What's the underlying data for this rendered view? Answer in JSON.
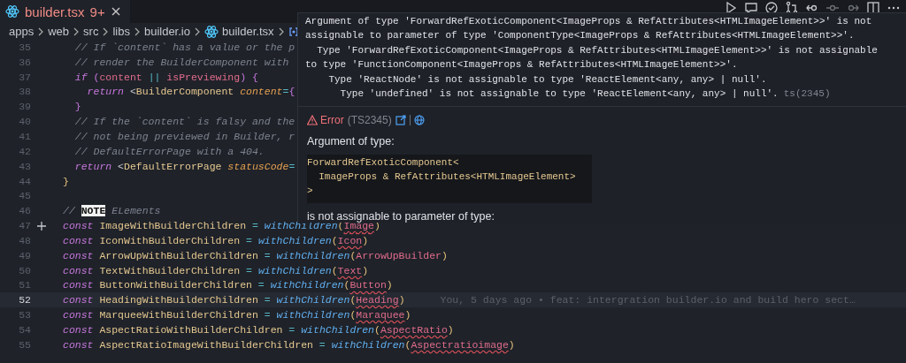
{
  "tabs": [
    {
      "label": "builder.tsx",
      "badge": "9+",
      "selected": true
    }
  ],
  "breadcrumb": [
    {
      "label": "apps",
      "kind": "folder"
    },
    {
      "label": "web",
      "kind": "folder"
    },
    {
      "label": "src",
      "kind": "folder"
    },
    {
      "label": "libs",
      "kind": "folder"
    },
    {
      "label": "builder.io",
      "kind": "folder"
    },
    {
      "label": "builder.tsx",
      "kind": "react"
    },
    {
      "kind": "symbol"
    }
  ],
  "editor": {
    "lines": [
      {
        "number": "35",
        "current": false,
        "added": false,
        "tokens": [
          {
            "kind": "comment",
            "text": "  // If `content` has a value or the p"
          }
        ]
      },
      {
        "number": "36",
        "current": false,
        "added": false,
        "tokens": [
          {
            "kind": "comment",
            "text": "  // render the BuilderComponent with"
          }
        ]
      },
      {
        "number": "37",
        "current": false,
        "added": false,
        "tokens": [
          {
            "kind": "keyword",
            "text": "  if"
          },
          {
            "kind": "punct",
            "text": " ("
          },
          {
            "kind": "var",
            "text": "content"
          },
          {
            "kind": "op",
            "text": " || "
          },
          {
            "kind": "var",
            "text": "isPreviewing"
          },
          {
            "kind": "punct",
            "text": ") {"
          }
        ]
      },
      {
        "number": "38",
        "current": false,
        "added": false,
        "tokens": [
          {
            "kind": "keyword",
            "text": "    return"
          },
          {
            "kind": "plain",
            "text": " <"
          },
          {
            "kind": "type",
            "text": "BuilderComponent"
          },
          {
            "kind": "attr",
            "text": " content"
          },
          {
            "kind": "op",
            "text": "="
          },
          {
            "kind": "punct",
            "text": "{"
          }
        ]
      },
      {
        "number": "39",
        "current": false,
        "added": false,
        "tokens": [
          {
            "kind": "punct",
            "text": "  }"
          }
        ]
      },
      {
        "number": "40",
        "current": false,
        "added": false,
        "tokens": [
          {
            "kind": "comment",
            "text": "  // If the `content` is falsy and the"
          }
        ]
      },
      {
        "number": "41",
        "current": false,
        "added": false,
        "tokens": [
          {
            "kind": "comment",
            "text": "  // not being previewed in Builder, r"
          }
        ]
      },
      {
        "number": "42",
        "current": false,
        "added": false,
        "tokens": [
          {
            "kind": "comment",
            "text": "  // DefaultErrorPage with a 404."
          }
        ]
      },
      {
        "number": "43",
        "current": false,
        "added": false,
        "tokens": [
          {
            "kind": "keyword",
            "text": "  return"
          },
          {
            "kind": "plain",
            "text": " <"
          },
          {
            "kind": "type",
            "text": "DefaultErrorPage"
          },
          {
            "kind": "attr",
            "text": " statusCode"
          },
          {
            "kind": "op",
            "text": "="
          }
        ]
      },
      {
        "number": "44",
        "current": false,
        "added": false,
        "tokens": [
          {
            "kind": "brace",
            "text": "}"
          }
        ]
      },
      {
        "number": "45",
        "current": false,
        "added": false
      },
      {
        "number": "46",
        "current": false,
        "added": false,
        "tokens": [
          {
            "kind": "comment",
            "text": "// "
          },
          {
            "kind": "note",
            "text": "NOTE"
          },
          {
            "kind": "comment",
            "text": " ELements"
          }
        ]
      },
      {
        "number": "47",
        "current": false,
        "added": true,
        "tokens": [
          {
            "kind": "keyword",
            "text": "const"
          },
          {
            "kind": "type",
            "text": " ImageWithBuilderChildren"
          },
          {
            "kind": "op",
            "text": " = "
          },
          {
            "kind": "func",
            "text": "withChildren"
          },
          {
            "kind": "brace",
            "text": "("
          },
          {
            "kind": "errvar",
            "text": "Image"
          },
          {
            "kind": "brace",
            "text": ")"
          }
        ]
      },
      {
        "number": "48",
        "current": false,
        "added": false,
        "tokens": [
          {
            "kind": "keyword",
            "text": "const"
          },
          {
            "kind": "type",
            "text": " IconWithBuilderChildren"
          },
          {
            "kind": "op",
            "text": " = "
          },
          {
            "kind": "func",
            "text": "withChildren"
          },
          {
            "kind": "brace",
            "text": "("
          },
          {
            "kind": "errvar",
            "text": "Icon"
          },
          {
            "kind": "brace",
            "text": ")"
          }
        ]
      },
      {
        "number": "49",
        "current": false,
        "added": false,
        "tokens": [
          {
            "kind": "keyword",
            "text": "const"
          },
          {
            "kind": "type",
            "text": " ArrowUpWithBuilderChildren"
          },
          {
            "kind": "op",
            "text": " = "
          },
          {
            "kind": "func",
            "text": "withChildren"
          },
          {
            "kind": "brace",
            "text": "("
          },
          {
            "kind": "var",
            "text": "ArrowUpBuilder"
          },
          {
            "kind": "brace",
            "text": ")"
          }
        ]
      },
      {
        "number": "50",
        "current": false,
        "added": false,
        "tokens": [
          {
            "kind": "keyword",
            "text": "const"
          },
          {
            "kind": "type",
            "text": " TextWithBuilderChildren"
          },
          {
            "kind": "op",
            "text": " = "
          },
          {
            "kind": "func",
            "text": "withChildren"
          },
          {
            "kind": "brace",
            "text": "("
          },
          {
            "kind": "errvar",
            "text": "Text"
          },
          {
            "kind": "brace",
            "text": ")"
          }
        ]
      },
      {
        "number": "51",
        "current": false,
        "added": false,
        "tokens": [
          {
            "kind": "keyword",
            "text": "const"
          },
          {
            "kind": "type",
            "text": " ButtonWithBuilderChildren"
          },
          {
            "kind": "op",
            "text": " = "
          },
          {
            "kind": "func",
            "text": "withChildren"
          },
          {
            "kind": "brace",
            "text": "("
          },
          {
            "kind": "errvar",
            "text": "Button"
          },
          {
            "kind": "brace",
            "text": ")"
          }
        ]
      },
      {
        "number": "52",
        "current": true,
        "added": false,
        "blame": "You, 5 days ago • feat: intergration builder.io and build hero sect…",
        "tokens": [
          {
            "kind": "keyword",
            "text": "const"
          },
          {
            "kind": "type",
            "text": " HeadingWithBuilderChildren"
          },
          {
            "kind": "op",
            "text": " = "
          },
          {
            "kind": "func",
            "text": "withChildren"
          },
          {
            "kind": "brace",
            "text": "("
          },
          {
            "kind": "errvar",
            "text": "Heading"
          },
          {
            "kind": "brace",
            "text": ")"
          }
        ]
      },
      {
        "number": "53",
        "current": false,
        "added": false,
        "tokens": [
          {
            "kind": "keyword",
            "text": "const"
          },
          {
            "kind": "type",
            "text": " MarqueeWithBuilderChildren"
          },
          {
            "kind": "op",
            "text": " = "
          },
          {
            "kind": "func",
            "text": "withChildren"
          },
          {
            "kind": "brace",
            "text": "("
          },
          {
            "kind": "errvar",
            "text": "Maraquee"
          },
          {
            "kind": "brace",
            "text": ")"
          }
        ]
      },
      {
        "number": "54",
        "current": false,
        "added": false,
        "tokens": [
          {
            "kind": "keyword",
            "text": "const"
          },
          {
            "kind": "type",
            "text": " AspectRatioWithBuilderChildren"
          },
          {
            "kind": "op",
            "text": " = "
          },
          {
            "kind": "func",
            "text": "withChildren"
          },
          {
            "kind": "brace",
            "text": "("
          },
          {
            "kind": "errvar",
            "text": "AspectRatio"
          },
          {
            "kind": "brace",
            "text": ")"
          }
        ]
      },
      {
        "number": "55",
        "current": false,
        "added": false,
        "tokens": [
          {
            "kind": "keyword",
            "text": "const"
          },
          {
            "kind": "type",
            "text": " AspectRatioImageWithBuilderChildren"
          },
          {
            "kind": "op",
            "text": " = "
          },
          {
            "kind": "func",
            "text": "withChildren"
          },
          {
            "kind": "brace",
            "text": "("
          },
          {
            "kind": "errvar",
            "text": "Aspectratioimage"
          },
          {
            "kind": "brace",
            "text": ")"
          }
        ]
      }
    ]
  },
  "hover": {
    "message_lines": [
      "Argument of type 'ForwardRefExoticComponent<ImageProps & RefAttributes<HTMLImageElement>>' is not",
      "assignable to parameter of type 'ComponentType<ImageProps & RefAttributes<HTMLImageElement>>'.",
      "  Type 'ForwardRefExoticComponent<ImageProps & RefAttributes<HTMLImageElement>>' is not assignable",
      "to type 'FunctionComponent<ImageProps & RefAttributes<HTMLImageElement>>'.",
      "    Type 'ReactNode' is not assignable to type 'ReactElement<any, any> | null'.",
      "      Type 'undefined' is not assignable to type 'ReactElement<any, any> | null'."
    ],
    "source": "ts(2345)",
    "severity": "Error",
    "code": "(TS2345)",
    "intro": "Argument of type:",
    "type_block": [
      "ForwardRefExoticComponent<",
      "  ImageProps & RefAttributes<HTMLImageElement>",
      ">"
    ],
    "outro": "is not assignable to parameter of type:"
  }
}
